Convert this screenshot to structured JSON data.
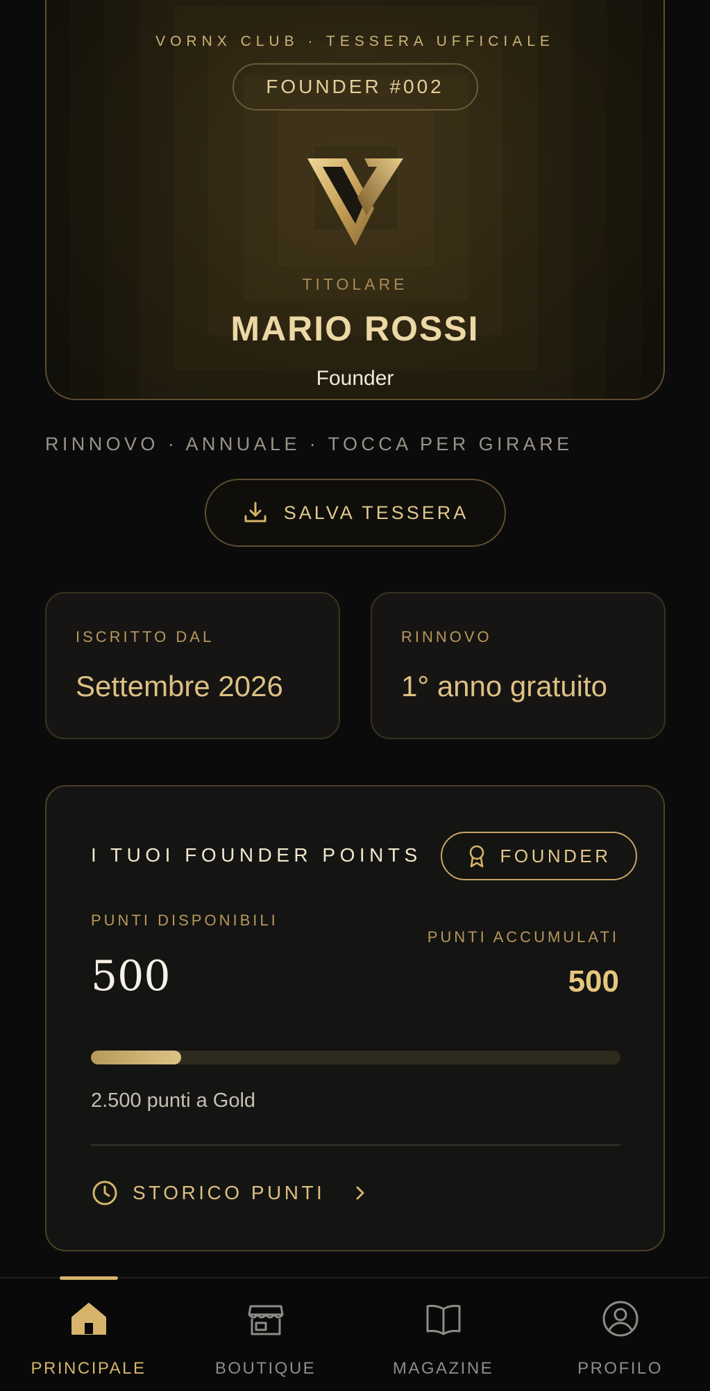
{
  "card": {
    "header": "VORNX CLUB · TESSERA UFFICIALE",
    "badge": "FOUNDER #002",
    "holder_label": "TITOLARE",
    "holder_name": "MARIO ROSSI",
    "holder_role": "Founder",
    "logo_icon": "vornx-v-logo"
  },
  "card_caption": "RINNOVO · ANNUALE · TOCCA PER GIRARE",
  "save_button": {
    "label": "SALVA TESSERA",
    "icon": "download-icon"
  },
  "tiles": [
    {
      "label": "ISCRITTO DAL",
      "value": "Settembre 2026"
    },
    {
      "label": "RINNOVO",
      "value": "1° anno gratuito"
    }
  ],
  "points": {
    "title": "I TUOI FOUNDER POINTS",
    "badge": "FOUNDER",
    "badge_icon": "award-icon",
    "available_label": "PUNTI DISPONIBILI",
    "available_value": "500",
    "accumulated_label": "PUNTI ACCUMULATI",
    "accumulated_value": "500",
    "progress_percent": 17,
    "progress_note": "2.500 punti a Gold",
    "history_label": "STORICO PUNTI",
    "history_icon": "clock-icon"
  },
  "nav": [
    {
      "label": "PRINCIPALE",
      "icon": "home-icon",
      "active": true
    },
    {
      "label": "BOUTIQUE",
      "icon": "store-icon",
      "active": false
    },
    {
      "label": "MAGAZINE",
      "icon": "book-icon",
      "active": false
    },
    {
      "label": "PROFILO",
      "icon": "user-circle-icon",
      "active": false
    }
  ],
  "colors": {
    "background": "#0b0b0b",
    "accent_gold": "#d6b46c",
    "nav_inactive": "#8f8c86"
  }
}
